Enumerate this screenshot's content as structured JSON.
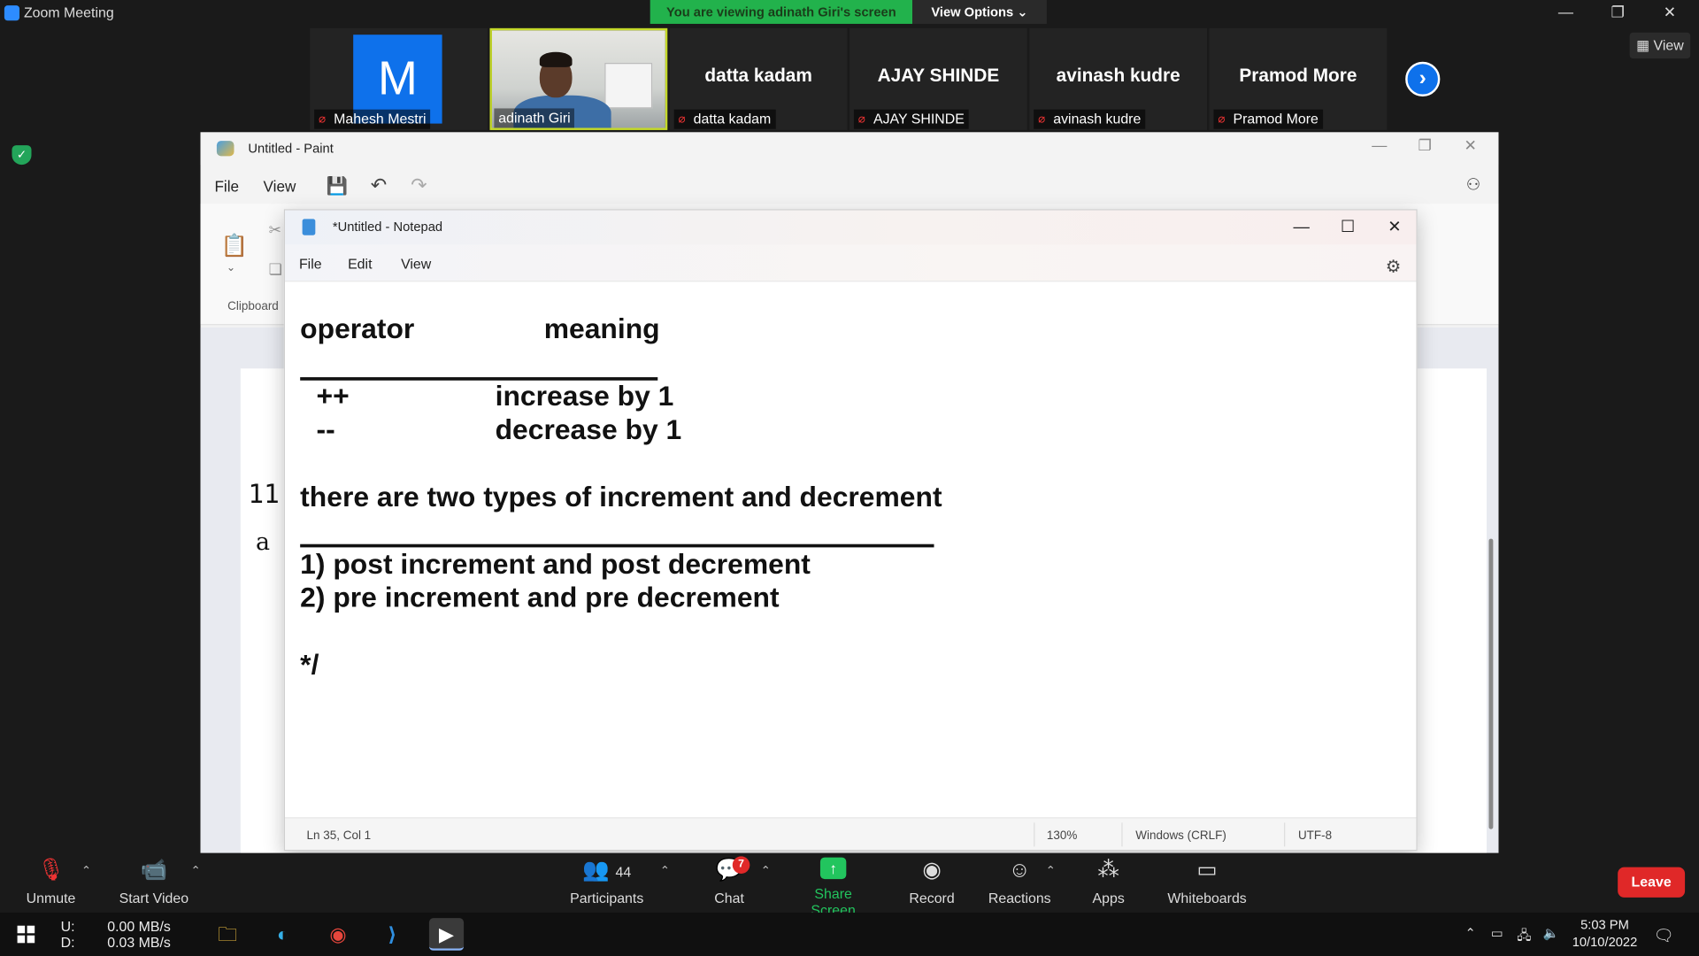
{
  "zoom": {
    "window_title": "Zoom Meeting",
    "banner": "You are viewing adinath Giri's screen",
    "view_options": "View Options ⌄",
    "view_button": "View",
    "participants_strip": [
      {
        "big": "",
        "label": "Mahesh Mestri",
        "avatar": "M"
      },
      {
        "big": "",
        "label": "adinath Giri"
      },
      {
        "big": "datta kadam",
        "label": "datta kadam"
      },
      {
        "big": "AJAY SHINDE",
        "label": "AJAY SHINDE"
      },
      {
        "big": "avinash kudre",
        "label": "avinash kudre"
      },
      {
        "big": "Pramod More",
        "label": "Pramod More"
      }
    ],
    "toolbar": {
      "unmute": "Unmute",
      "start_video": "Start Video",
      "participants": "Participants",
      "participants_count": "44",
      "chat": "Chat",
      "chat_badge": "7",
      "share_screen": "Share Screen",
      "record": "Record",
      "reactions": "Reactions",
      "apps": "Apps",
      "whiteboards": "Whiteboards",
      "leave": "Leave"
    }
  },
  "paint": {
    "title": "Untitled - Paint",
    "menu": [
      "File",
      "View"
    ],
    "clipboard_label": "Clipboard",
    "canvas_number": "11",
    "canvas_letter": "a"
  },
  "notepad": {
    "title": "*Untitled - Notepad",
    "menu": [
      "File",
      "Edit",
      "View"
    ],
    "lines": {
      "heading_operator": "operator",
      "heading_meaning": "meaning",
      "op1": "++",
      "op1_meaning": "increase by 1",
      "op2": "--",
      "op2_meaning": "decrease by 1",
      "types": "there are two types of increment and decrement",
      "type1": "1) post increment and post decrement",
      "type2": "2) pre increment and pre decrement",
      "close_comment": "*/"
    },
    "status": {
      "position": "Ln 35, Col 1",
      "zoom": "130%",
      "line_endings": "Windows (CRLF)",
      "encoding": "UTF-8"
    }
  },
  "taskbar": {
    "upload_label": "U:",
    "download_label": "D:",
    "upload_rate": "0.00 MB/s",
    "download_rate": "0.03 MB/s",
    "time": "5:03 PM",
    "date": "10/10/2022"
  },
  "colors": {
    "banner_green": "#22b24c",
    "zoom_blue": "#0e71eb",
    "leave_red": "#e02828",
    "muted_red": "#e33333"
  }
}
